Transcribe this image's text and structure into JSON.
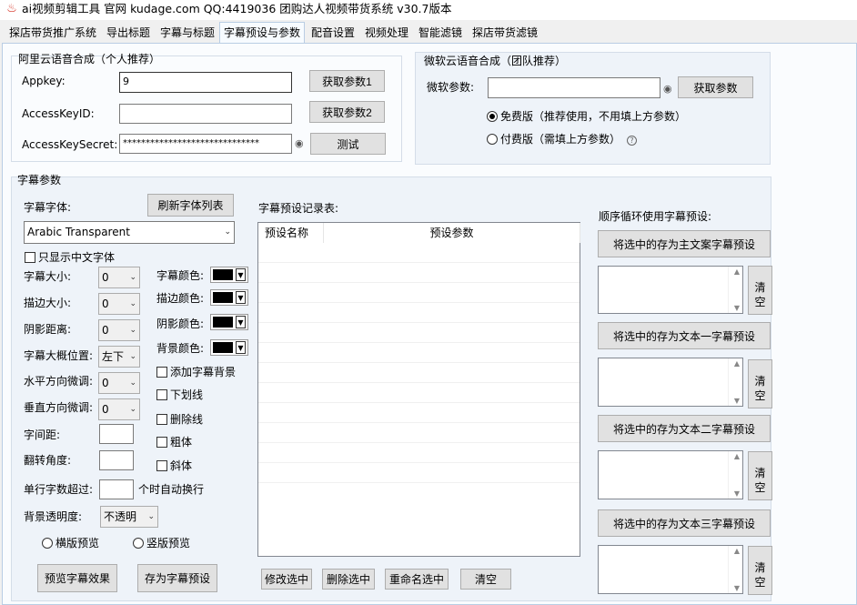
{
  "window": {
    "title": "ai视频剪辑工具 官网 kudage.com QQ:4419036     团购达人视频带货系统    v30.7版本"
  },
  "tabs": [
    {
      "label": "探店带货推广系统"
    },
    {
      "label": "导出标题"
    },
    {
      "label": "字幕与标题"
    },
    {
      "label": "字幕预设与参数"
    },
    {
      "label": "配音设置"
    },
    {
      "label": "视频处理"
    },
    {
      "label": "智能滤镜"
    },
    {
      "label": "探店带货滤镜"
    }
  ],
  "aliyun": {
    "title": "阿里云语音合成（个人推荐）",
    "appkey_label": "Appkey:",
    "appkey_value": "             9",
    "accesskeyid_label": "AccessKeyID:",
    "accesskeyid_value": "",
    "accesskeysecret_label": "AccessKeySecret:",
    "accesskeysecret_value": "******************************",
    "get_param1_label": "获取参数1",
    "get_param2_label": "获取参数2",
    "test_label": "测试"
  },
  "microsoft": {
    "title": "微软云语音合成（团队推荐）",
    "param_label": "微软参数:",
    "param_value": "",
    "get_param_label": "获取参数",
    "free_label": "免费版（推荐使用，不用填上方参数）",
    "paid_label": "付费版（需填上方参数）",
    "selected": "free"
  },
  "subtitle": {
    "section_title": "字幕参数",
    "font_label": "字幕字体:",
    "refresh_fonts_label": "刷新字体列表",
    "font_value": "Arabic Transparent",
    "only_cn_label": "只显示中文字体",
    "size_label": "字幕大小:",
    "size_value": "0",
    "stroke_label": "描边大小:",
    "stroke_value": "0",
    "shadow_label": "阴影距离:",
    "shadow_value": "0",
    "position_label": "字幕大概位置:",
    "position_value": "左下",
    "hshift_label": "水平方向微调:",
    "hshift_value": "0",
    "vshift_label": "垂直方向微调:",
    "vshift_value": "0",
    "spacing_label": "字间距:",
    "spacing_value": "",
    "rotate_label": "翻转角度:",
    "rotate_value": "",
    "wrap_label": "单行字数超过:",
    "wrap_value": "",
    "wrap_suffix": "个时自动换行",
    "bg_alpha_label": "背景透明度:",
    "bg_alpha_value": "不透明",
    "color_label": "字幕颜色:",
    "stroke_color_label": "描边颜色:",
    "shadow_color_label": "阴影颜色:",
    "bg_color_label": "背景颜色:",
    "add_bg_label": "添加字幕背景",
    "underline_label": "下划线",
    "strike_label": "删除线",
    "bold_label": "粗体",
    "italic_label": "斜体",
    "horizontal_preview_label": "横版预览",
    "vertical_preview_label": "竖版预览",
    "preview_btn_label": "预览字幕效果",
    "save_preset_label": "存为字幕预设",
    "colors": {
      "text": "#000000",
      "stroke": "#000000",
      "shadow": "#000000",
      "bg": "#000000"
    }
  },
  "presets": {
    "title": "字幕预设记录表:",
    "col_name": "预设名称",
    "col_params": "预设参数",
    "modify_label": "修改选中",
    "delete_label": "删除选中",
    "rename_label": "重命名选中",
    "clear_label": "清空"
  },
  "cycle": {
    "title": "顺序循环使用字幕预设:",
    "main_label": "将选中的存为主文案字幕预设",
    "text1_label": "将选中的存为文本一字幕预设",
    "text2_label": "将选中的存为文本二字幕预设",
    "text3_label": "将选中的存为文本三字幕预设",
    "clear_label": "清\n空"
  }
}
